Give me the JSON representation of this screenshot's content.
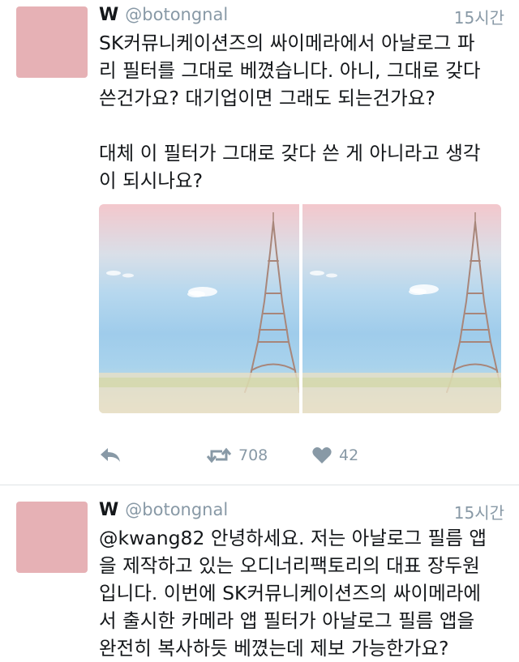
{
  "tweets": [
    {
      "name": "W",
      "handle": "@botongnal",
      "time": "15시간",
      "text": "SK커뮤니케이션즈의 싸이메라에서 아날로그 파\n리 필터를 그대로 베꼈습니다. 아니, 그대로 갖다\n쓴건가요? 대기업이면 그래도 되는건가요?\n\n대체 이 필터가 그대로 갖다 쓴 게 아니라고 생각\n이 되시나요?",
      "retweets": "708",
      "likes": "42"
    },
    {
      "name": "W",
      "handle": "@botongnal",
      "time": "15시간",
      "text": "@kwang82 안녕하세요. 저는 아날로그 필름 앱\n을 제작하고 있는 오디너리팩토리의 대표 장두원\n입니다. 이번에 SK커뮤니케이션즈의 싸이메라에\n서 출시한 카메라 앱 필터가 아날로그 필름 앱을\n완전히 복사하듯 베꼈는데 제보 가능한가요?"
    }
  ],
  "colors": {
    "avatar": "#e6b1b5",
    "muted": "#8899a6",
    "text": "#14171a",
    "divider": "#dfe3e6"
  },
  "icons": [
    "reply-icon",
    "retweet-icon",
    "like-icon"
  ]
}
